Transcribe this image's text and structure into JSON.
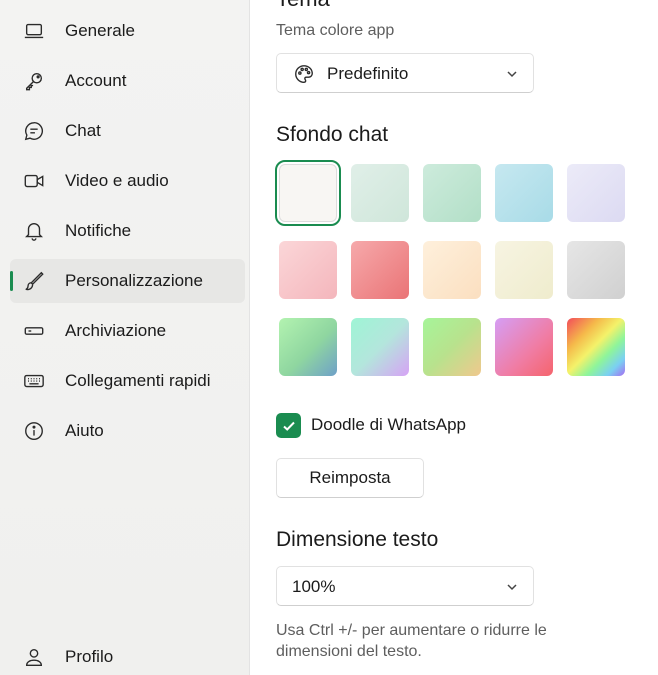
{
  "sidebar": {
    "items": [
      {
        "label": "Generale",
        "icon": "laptop-icon"
      },
      {
        "label": "Account",
        "icon": "key-icon"
      },
      {
        "label": "Chat",
        "icon": "chat-bubble-icon"
      },
      {
        "label": "Video e audio",
        "icon": "video-camera-icon"
      },
      {
        "label": "Notifiche",
        "icon": "bell-icon"
      },
      {
        "label": "Personalizzazione",
        "icon": "brush-icon",
        "active": true
      },
      {
        "label": "Archiviazione",
        "icon": "storage-drive-icon"
      },
      {
        "label": "Collegamenti rapidi",
        "icon": "keyboard-icon"
      },
      {
        "label": "Aiuto",
        "icon": "info-icon"
      }
    ],
    "profile": {
      "label": "Profilo",
      "icon": "person-icon"
    }
  },
  "theme": {
    "title_partial": "Tema",
    "sublabel": "Tema colore app",
    "dropdown_value": "Predefinito",
    "dropdown_icon": "palette-icon"
  },
  "chat_background": {
    "title": "Sfondo chat",
    "selected_index": 0,
    "swatches": [
      {
        "name": "white",
        "fill": "#f8f6f3"
      },
      {
        "name": "mint-light",
        "fill": "linear-gradient(135deg,#e0efe8,#cfe6da)"
      },
      {
        "name": "mint",
        "fill": "linear-gradient(135deg,#cdebdc,#b2dfc7)"
      },
      {
        "name": "sky",
        "fill": "linear-gradient(135deg,#c6e8f0,#a8dbe7)"
      },
      {
        "name": "lavender",
        "fill": "linear-gradient(135deg,#ecebf8,#dcdaf2)"
      },
      {
        "name": "pink-light",
        "fill": "linear-gradient(135deg,#fbd6d8,#f4b6bc)"
      },
      {
        "name": "coral",
        "fill": "linear-gradient(135deg,#f6a9ab,#ea7476)"
      },
      {
        "name": "peach",
        "fill": "linear-gradient(135deg,#fef0dc,#fbdfc0)"
      },
      {
        "name": "cream",
        "fill": "linear-gradient(135deg,#f7f4e2,#efeccd)"
      },
      {
        "name": "grey",
        "fill": "linear-gradient(135deg,#e6e6e6,#d0d0d0)"
      },
      {
        "name": "green-blue",
        "fill": "linear-gradient(135deg,#b3f3b0,#8fd6a0 55%,#6ea0c8)"
      },
      {
        "name": "aqua-purple",
        "fill": "linear-gradient(135deg,#9ef5d5,#b3e6dc 50%,#d6a3f5)"
      },
      {
        "name": "green-yellow",
        "fill": "linear-gradient(135deg,#a6f59a,#b8e28d 50%,#f0c88d)"
      },
      {
        "name": "purple-pink",
        "fill": "linear-gradient(135deg,#d59ef5,#f07ca3 60%,#f5646c)"
      },
      {
        "name": "rainbow",
        "fill": "linear-gradient(135deg,#f24b5a 0%,#f5b94a 28%,#f4f26a 48%,#8ef59a 66%,#7ad0f2 84%,#a56cf2 100%)"
      }
    ]
  },
  "doodle": {
    "label": "Doodle di WhatsApp",
    "checked": true
  },
  "reset_button": {
    "label": "Reimposta"
  },
  "text_size": {
    "title": "Dimensione testo",
    "dropdown_value": "100%",
    "hint": "Usa Ctrl +/- per aumentare o ridurre le dimensioni del testo."
  },
  "colors": {
    "accent": "#1a8c50"
  }
}
